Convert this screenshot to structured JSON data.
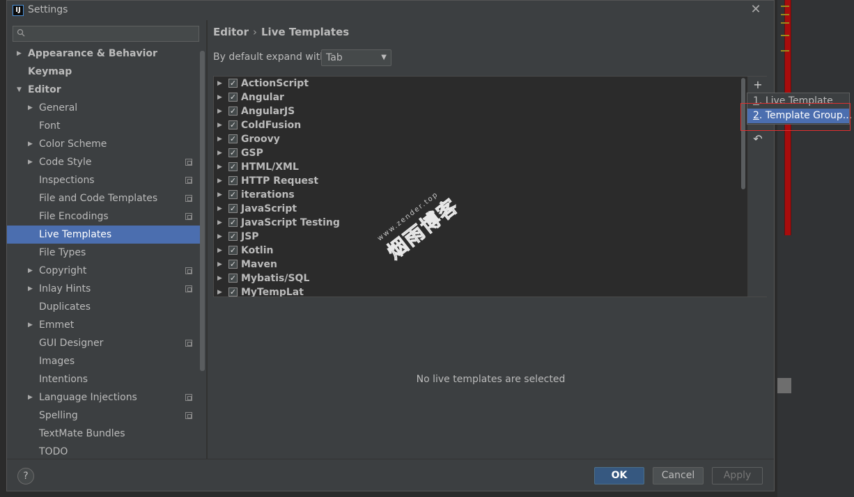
{
  "window": {
    "title": "Settings",
    "app_icon": "IJ"
  },
  "search": {
    "placeholder": ""
  },
  "sidebar": {
    "items": [
      {
        "label": "Appearance & Behavior",
        "arrow": "▶",
        "bold": true
      },
      {
        "label": "Keymap",
        "arrow": "",
        "bold": true
      },
      {
        "label": "Editor",
        "arrow": "▼",
        "bold": true
      },
      {
        "label": "General",
        "arrow": "▶"
      },
      {
        "label": "Font",
        "arrow": ""
      },
      {
        "label": "Color Scheme",
        "arrow": "▶"
      },
      {
        "label": "Code Style",
        "arrow": "▶",
        "copy_icon": true
      },
      {
        "label": "Inspections",
        "arrow": "",
        "copy_icon": true
      },
      {
        "label": "File and Code Templates",
        "arrow": "",
        "copy_icon": true
      },
      {
        "label": "File Encodings",
        "arrow": "",
        "copy_icon": true
      },
      {
        "label": "Live Templates",
        "arrow": "",
        "selected": true
      },
      {
        "label": "File Types",
        "arrow": ""
      },
      {
        "label": "Copyright",
        "arrow": "▶",
        "copy_icon": true
      },
      {
        "label": "Inlay Hints",
        "arrow": "▶",
        "copy_icon": true
      },
      {
        "label": "Duplicates",
        "arrow": ""
      },
      {
        "label": "Emmet",
        "arrow": "▶"
      },
      {
        "label": "GUI Designer",
        "arrow": "",
        "copy_icon": true
      },
      {
        "label": "Images",
        "arrow": ""
      },
      {
        "label": "Intentions",
        "arrow": ""
      },
      {
        "label": "Language Injections",
        "arrow": "▶",
        "copy_icon": true
      },
      {
        "label": "Spelling",
        "arrow": "",
        "copy_icon": true
      },
      {
        "label": "TextMate Bundles",
        "arrow": ""
      },
      {
        "label": "TODO",
        "arrow": ""
      }
    ]
  },
  "breadcrumb": {
    "parent": "Editor",
    "separator": "›",
    "current": "Live Templates"
  },
  "expand": {
    "label": "By default expand with",
    "value": "Tab",
    "caret": "▼"
  },
  "templates": {
    "groups": [
      "ActionScript",
      "Angular",
      "AngularJS",
      "ColdFusion",
      "Groovy",
      "GSP",
      "HTML/XML",
      "HTTP Request",
      "iterations",
      "JavaScript",
      "JavaScript Testing",
      "JSP",
      "Kotlin",
      "Maven",
      "Mybatis/SQL",
      "MyTempLat"
    ],
    "arrow": "▶",
    "check": "✓",
    "empty_message": "No live templates are selected"
  },
  "toolbar": {
    "add": "+",
    "undo": "↶"
  },
  "popup": {
    "items": [
      {
        "mnemonic": "1",
        "label": ". Live Template"
      },
      {
        "mnemonic": "2",
        "label": ". Template Group..."
      }
    ]
  },
  "buttons": {
    "help": "?",
    "ok": "OK",
    "cancel": "Cancel",
    "apply": "Apply",
    "close": "✕"
  },
  "watermark": {
    "url": "www.zender.top",
    "name": "烟雨博客"
  },
  "colors": {
    "selection": "#4b6eaf",
    "ok_button": "#365880",
    "highlight_frame": "#e03030"
  }
}
